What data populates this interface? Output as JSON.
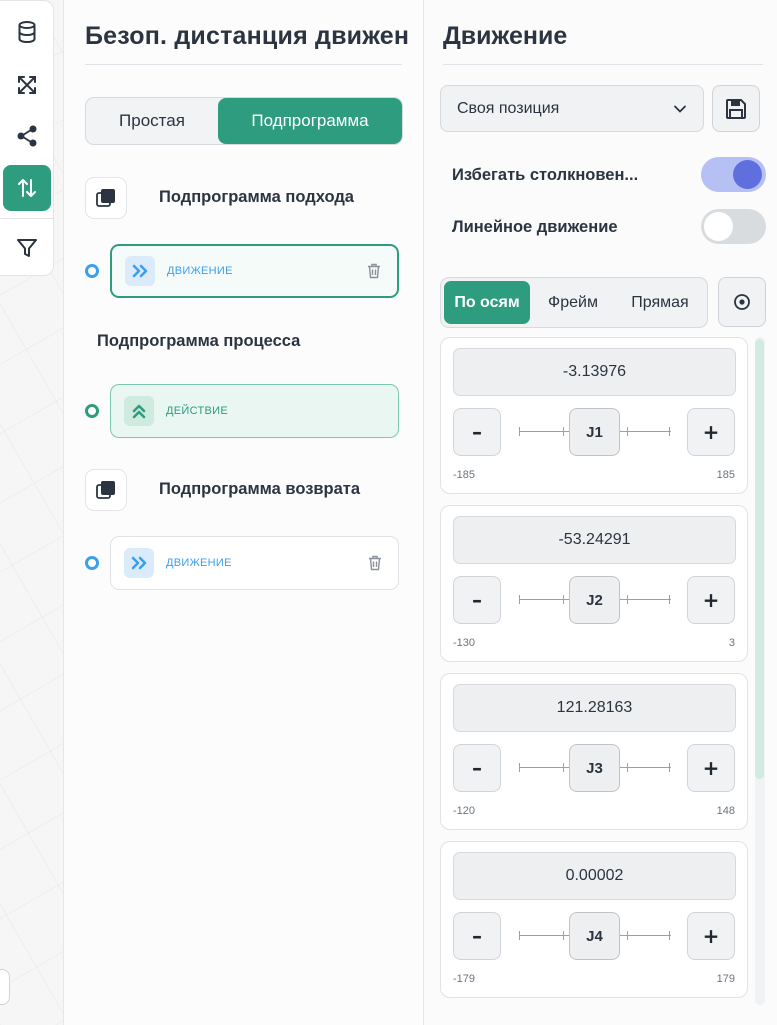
{
  "colors": {
    "accent": "#2e9c7e",
    "blue": "#3aa0ee",
    "toggle_on": "#5f70de"
  },
  "toolbar": {
    "tools": [
      {
        "icon": "database-icon"
      },
      {
        "icon": "expand-arrows-icon"
      },
      {
        "icon": "share-nodes-icon"
      },
      {
        "icon": "sort-arrows-icon",
        "active": true
      },
      {
        "icon": "filter-icon"
      }
    ]
  },
  "left_panel": {
    "title": "Безоп. дистанция движен",
    "mode": {
      "options": [
        "Простая",
        "Подпрограмма"
      ],
      "selected": "Подпрограмма"
    },
    "approach": {
      "title": "Подпрограмма подхода",
      "step": "движение"
    },
    "process": {
      "title": "Подпрограмма процесса",
      "step": "действие"
    },
    "return": {
      "title": "Подпрограмма возврата",
      "step": "движение"
    }
  },
  "right_panel": {
    "title": "Движение",
    "position_select": "Своя позиция",
    "avoid_collision": {
      "label": "Избегать столкновен...",
      "on": true
    },
    "linear_motion": {
      "label": "Линейное движение",
      "on": false
    },
    "tabs": [
      "По осям",
      "Фрейм",
      "Прямая"
    ],
    "active_tab": "По осям",
    "joints": [
      {
        "name": "J1",
        "value": "-3.13976",
        "min": "-185",
        "max": "185"
      },
      {
        "name": "J2",
        "value": "-53.24291",
        "min": "-130",
        "max": "3"
      },
      {
        "name": "J3",
        "value": "121.28163",
        "min": "-120",
        "max": "148"
      },
      {
        "name": "J4",
        "value": "0.00002",
        "min": "-179",
        "max": "179"
      }
    ],
    "minus": "–",
    "plus": "+"
  }
}
